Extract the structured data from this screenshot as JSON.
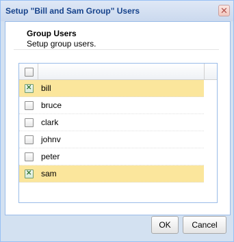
{
  "dialog": {
    "title": "Setup \"Bill and Sam Group\" Users",
    "close_glyph": "✕"
  },
  "header": {
    "title": "Group Users",
    "subtitle": "Setup group users."
  },
  "grid": {
    "rows": [
      {
        "label": "bill",
        "checked": true
      },
      {
        "label": "bruce",
        "checked": false
      },
      {
        "label": "clark",
        "checked": false
      },
      {
        "label": "johnv",
        "checked": false
      },
      {
        "label": "peter",
        "checked": false
      },
      {
        "label": "sam",
        "checked": true
      }
    ]
  },
  "buttons": {
    "ok": "OK",
    "cancel": "Cancel"
  }
}
